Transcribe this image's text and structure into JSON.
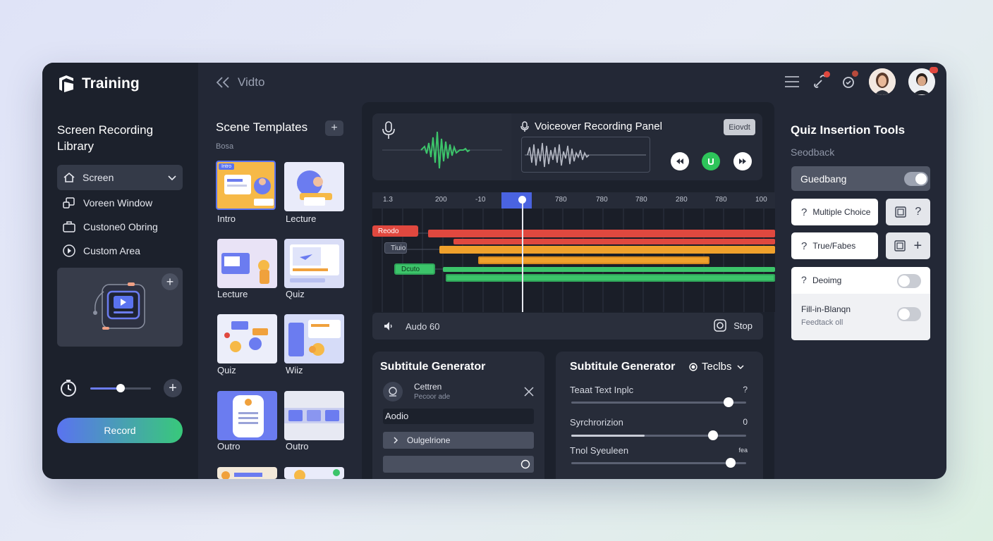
{
  "brand": {
    "title": "Training"
  },
  "header": {
    "back_label": "Vidto"
  },
  "sidebar": {
    "library_title": "Screen Recording Library",
    "select_value": "Screen",
    "sources": [
      {
        "label": "Voreen Window",
        "icon": "window-icon"
      },
      {
        "label": "Custone0 Obring",
        "icon": "briefcase-icon"
      },
      {
        "label": "Custom Area",
        "icon": "target-icon"
      }
    ],
    "slider_value": 0.5,
    "record_label": "Record"
  },
  "templates": {
    "title": "Scene Templates",
    "subtitle": "Bosa",
    "badge": "Intro",
    "items": [
      {
        "label": "Intro"
      },
      {
        "label": "Lecture"
      },
      {
        "label": "Lecture"
      },
      {
        "label": "Quiz"
      },
      {
        "label": "Quiz"
      },
      {
        "label": "Wiiz"
      },
      {
        "label": "Outro"
      },
      {
        "label": "Outro"
      }
    ]
  },
  "voiceover": {
    "title": "Voiceover Recording Panel",
    "tag": "Eiovdt"
  },
  "timeline": {
    "ticks": [
      "1.3",
      "200",
      "-10",
      "780",
      "780",
      "780",
      "280",
      "780",
      "100"
    ],
    "playhead_fraction": 0.37,
    "track_labels": [
      "Reodo",
      "Tiuio",
      "Dcuto"
    ]
  },
  "audio_bar": {
    "label": "Audo 60",
    "stop_label": "Stop"
  },
  "subtitle_left": {
    "title": "Subtitule Generator",
    "item_title": "Cettren",
    "item_sub": "Pecoor ade",
    "audio_label": "Aodio",
    "dropdown_label": "Oulgelrione"
  },
  "subtitle_right": {
    "title": "Subtitule Generator",
    "selector": "Teclbs",
    "sliders": [
      {
        "label": "Teaat Text Inplc",
        "value_text": "?",
        "value": 0.9
      },
      {
        "label": "Syrchrorizion",
        "value_text": "0",
        "value": 0.81
      },
      {
        "label": "Tnol Syeuleen",
        "value_text": "fea",
        "value": 0.91
      }
    ]
  },
  "quiz": {
    "title": "Quiz Insertion Tools",
    "subtitle": "Seodback",
    "toggle_row": {
      "label": "Guedbang",
      "on": true
    },
    "multiple_choice": "Multiple Choice",
    "true_false": "True/Fabes",
    "deoing": {
      "label": "Deoimg",
      "on": false
    },
    "fill": {
      "label": "Fill-in-Blanqn",
      "sub": "Feedtack oll",
      "on": false
    }
  },
  "colors": {
    "accent_blue": "#4a63e0",
    "red": "#e0483f",
    "orange": "#f0a12c",
    "green": "#3cc46a",
    "record_gradient_start": "#5a73f0",
    "record_gradient_end": "#38c97a"
  }
}
